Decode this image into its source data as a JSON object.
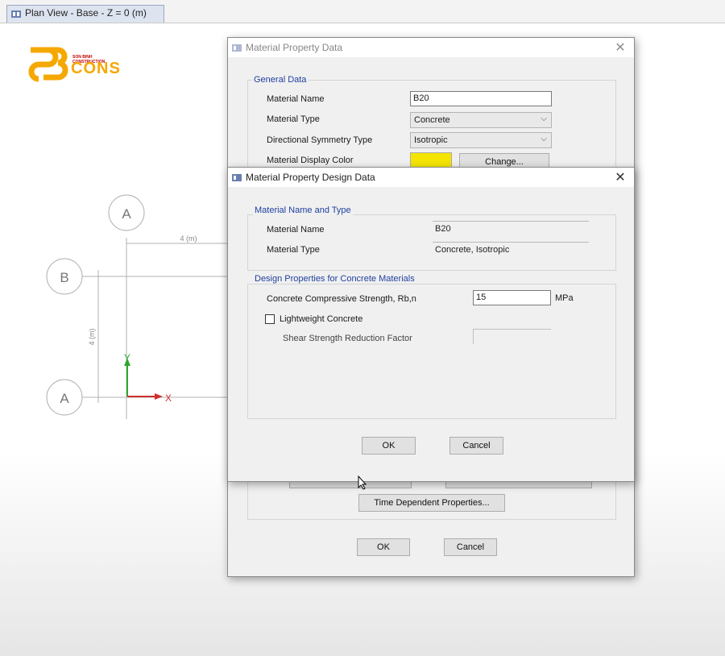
{
  "tab": {
    "label": "Plan View - Base - Z = 0 (m)"
  },
  "logo": {
    "tagline": "SON BINH CONSTRUCTION",
    "brand": "CONS"
  },
  "plan": {
    "grid_top": "A",
    "grid_b": "B",
    "grid_a": "A",
    "dim_x": "4 (m)",
    "dim_y": "4 (m)",
    "axis_y": "Y",
    "axis_x": "X"
  },
  "back_dialog": {
    "title": "Material Property Data",
    "general_data": "General Data",
    "material_name_label": "Material Name",
    "material_name_value": "B20",
    "material_type_label": "Material Type",
    "material_type_value": "Concrete",
    "symmetry_label": "Directional Symmetry Type",
    "symmetry_value": "Isotropic",
    "display_color_label": "Material Display Color",
    "change_button": "Change...",
    "time_dependent_button": "Time Dependent Properties...",
    "ok": "OK",
    "cancel": "Cancel"
  },
  "front_dialog": {
    "title": "Material Property Design Data",
    "group1": "Material Name and Type",
    "material_name_label": "Material Name",
    "material_name_value": "B20",
    "material_type_label": "Material Type",
    "material_type_value": "Concrete, Isotropic",
    "group2": "Design Properties for Concrete Materials",
    "strength_label": "Concrete Compressive Strength, Rb,n",
    "strength_value": "15",
    "strength_unit": "MPa",
    "lightweight_label": "Lightweight Concrete",
    "shear_label": "Shear Strength Reduction Factor",
    "ok": "OK",
    "cancel": "Cancel"
  },
  "colors": {
    "accent_text": "#1f3fa0",
    "swatch": "#f5e400",
    "logo_orange": "#f5a800"
  }
}
